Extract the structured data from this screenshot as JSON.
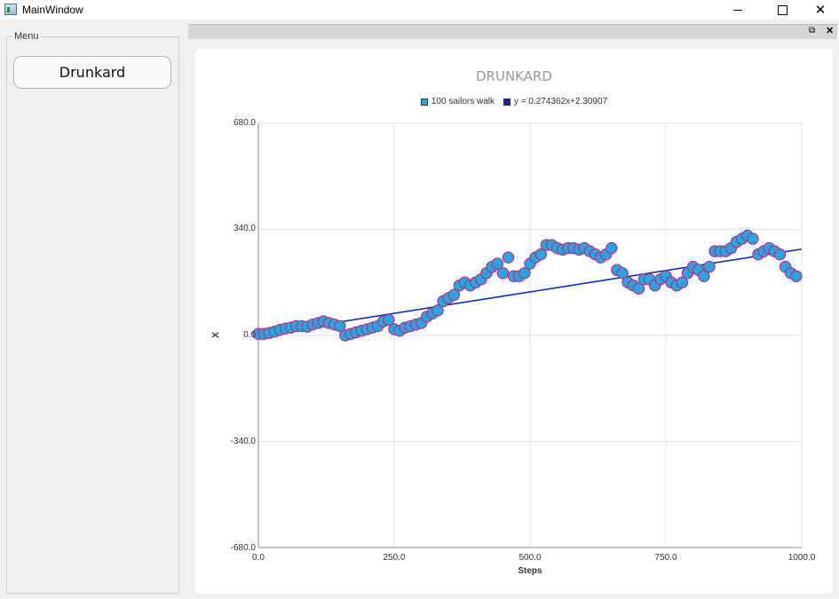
{
  "window": {
    "title": "MainWindow"
  },
  "menu": {
    "label": "Menu",
    "button_label": "Drunkard"
  },
  "chart_data": {
    "type": "scatter",
    "title": "DRUNKARD",
    "xlabel": "Steps",
    "ylabel": "X",
    "xlim": [
      0,
      1000
    ],
    "ylim": [
      -680,
      680
    ],
    "x_ticks": [
      "0.0",
      "250.0",
      "500.0",
      "750.0",
      "1000.0"
    ],
    "y_ticks": [
      "680.0",
      "340.0",
      "0.0",
      "-340.0",
      "-680.0"
    ],
    "grid": true,
    "legend_position": "top",
    "legend": [
      "100 sailors walk",
      "y = 0.274362x+2.30907"
    ],
    "colors": {
      "points_fill": "#2aa4e0",
      "points_edge": "#c0287a",
      "trend": "#0b2fc7"
    },
    "series": [
      {
        "name": "100 sailors walk",
        "x": [
          0,
          10,
          20,
          30,
          40,
          50,
          60,
          70,
          80,
          90,
          100,
          110,
          120,
          130,
          140,
          150,
          160,
          170,
          180,
          190,
          200,
          210,
          220,
          230,
          240,
          250,
          260,
          270,
          280,
          290,
          300,
          310,
          320,
          330,
          340,
          350,
          360,
          370,
          380,
          390,
          400,
          410,
          420,
          430,
          440,
          450,
          460,
          470,
          480,
          490,
          500,
          510,
          520,
          530,
          540,
          550,
          560,
          570,
          580,
          590,
          600,
          610,
          620,
          630,
          640,
          650,
          660,
          670,
          680,
          690,
          700,
          710,
          720,
          730,
          740,
          750,
          760,
          770,
          780,
          790,
          800,
          810,
          820,
          830,
          840,
          850,
          860,
          870,
          880,
          890,
          900,
          910,
          920,
          930,
          940,
          950,
          960,
          970,
          980,
          990
        ],
        "y": [
          5,
          5,
          8,
          12,
          18,
          22,
          25,
          30,
          30,
          28,
          35,
          40,
          45,
          40,
          35,
          30,
          0,
          5,
          10,
          15,
          20,
          25,
          30,
          45,
          50,
          20,
          15,
          25,
          30,
          35,
          40,
          60,
          70,
          80,
          110,
          120,
          130,
          160,
          170,
          160,
          170,
          180,
          200,
          220,
          230,
          200,
          250,
          190,
          190,
          200,
          230,
          250,
          260,
          290,
          290,
          280,
          275,
          280,
          280,
          275,
          280,
          270,
          260,
          250,
          260,
          280,
          210,
          200,
          170,
          160,
          150,
          180,
          180,
          160,
          180,
          190,
          170,
          160,
          170,
          200,
          220,
          210,
          190,
          220,
          270,
          270,
          270,
          280,
          300,
          310,
          320,
          310,
          260,
          270,
          280,
          270,
          260,
          220,
          200,
          190
        ]
      },
      {
        "name": "y = 0.274362x+2.30907",
        "type": "line",
        "x": [
          0,
          1000
        ],
        "y": [
          2.30907,
          276.67107
        ]
      }
    ]
  }
}
